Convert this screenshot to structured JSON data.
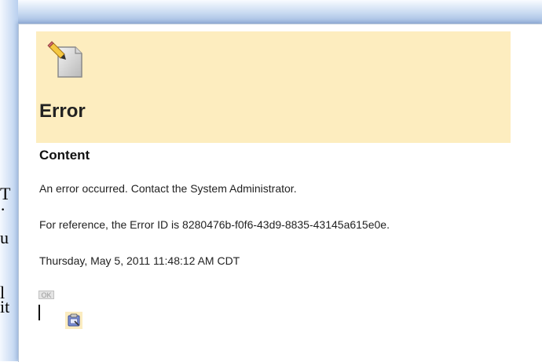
{
  "error": {
    "title": "Error",
    "icon": "document-edit-icon"
  },
  "content": {
    "heading": "Content",
    "message": "An error occurred. Contact the System Administrator.",
    "reference": "For reference, the Error ID is 8280476b-f0f6-43d9-8835-43145a615e0e.",
    "timestamp": "Thursday, May 5, 2011 11:48:12 AM CDT"
  },
  "actions": {
    "ok_label": "OK",
    "tray_icon": "clipboard-icon"
  },
  "background_text": {
    "fragments": [
      "T",
      "·",
      "u",
      "l",
      "it"
    ]
  },
  "colors": {
    "header_bg": "#fdedbf",
    "frame_blue": "#b9d0ef"
  }
}
